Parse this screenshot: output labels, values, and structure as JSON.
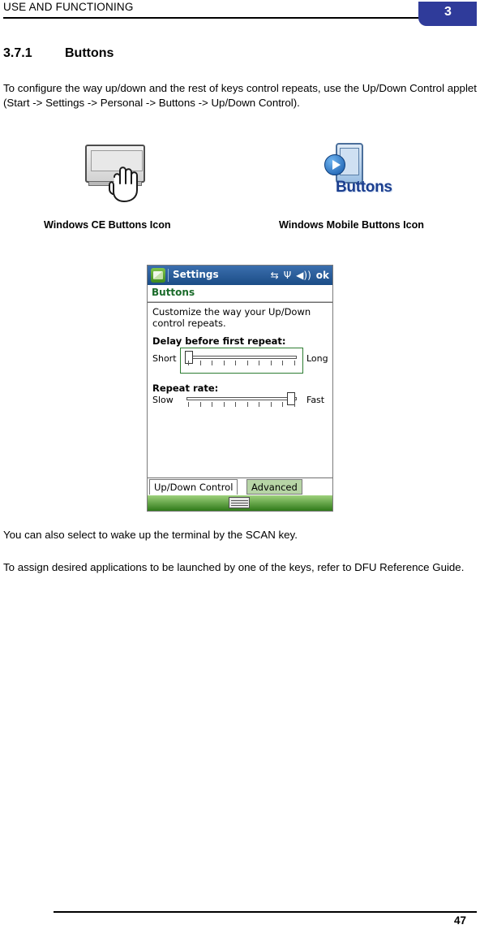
{
  "header": {
    "title": "USE AND FUNCTIONING",
    "chapter_number": "3"
  },
  "section": {
    "number": "3.7.1",
    "title": "Buttons"
  },
  "paragraphs": {
    "intro": "To configure the way up/down and the rest of keys control repeats, use the Up/Down Control applet (Start -> Settings -> Personal -> Buttons -> Up/Down Control).",
    "wake": "You can also select to wake up the terminal by the SCAN key.",
    "assign": "To assign desired applications to be launched by one of the keys, refer to DFU Reference Guide."
  },
  "figures": {
    "ce_caption": "Windows CE Buttons Icon",
    "wm_caption": "Windows Mobile Buttons Icon",
    "wm_icon_word": "Buttons"
  },
  "pda": {
    "titlebar": {
      "app": "Settings",
      "ok_label": "ok",
      "icons": [
        "connectivity-icon",
        "signal-off-icon",
        "volume-icon"
      ]
    },
    "app_title": "Buttons",
    "description": "Customize the way your Up/Down control repeats.",
    "delay": {
      "label": "Delay before first repeat:",
      "min_label": "Short",
      "max_label": "Long"
    },
    "repeat": {
      "label": "Repeat rate:",
      "min_label": "Slow",
      "max_label": "Fast"
    },
    "tabs": [
      {
        "label": "Up/Down Control",
        "selected": false
      },
      {
        "label": "Advanced",
        "selected": true
      }
    ]
  },
  "footer": {
    "page_number": "47"
  }
}
